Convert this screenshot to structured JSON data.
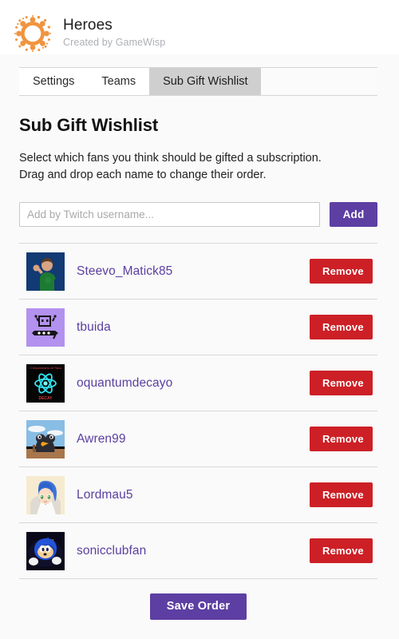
{
  "header": {
    "logo_icon": "gamewisp-sun-gear-icon",
    "title": "Heroes",
    "subtitle": "Created by GameWisp",
    "brand_color": "#f0943f"
  },
  "tabs": [
    {
      "label": "Settings",
      "active": false
    },
    {
      "label": "Teams",
      "active": false
    },
    {
      "label": "Sub Gift Wishlist",
      "active": true
    }
  ],
  "main": {
    "section_title": "Sub Gift Wishlist",
    "description_line1": "Select which fans you think should be gifted a subscription.",
    "description_line2": "Drag and drop each name to change their order."
  },
  "add_form": {
    "input_value": "",
    "input_placeholder": "Add by Twitch username...",
    "add_label": "Add",
    "add_color": "#5d3fa3"
  },
  "wishlist": {
    "remove_label": "Remove",
    "remove_color": "#cc2026",
    "name_color": "#5b3fa0",
    "items": [
      {
        "username": "Steevo_Matick85",
        "avatar_icon": "avatar-3d-person-waving-icon",
        "avatar_bg": "#123a73"
      },
      {
        "username": "tbuida",
        "avatar_icon": "avatar-pixel-creature-icon",
        "avatar_bg": "#b391ef"
      },
      {
        "username": "oquantumdecayo",
        "avatar_icon": "avatar-atom-icon",
        "avatar_bg": "#050505"
      },
      {
        "username": "Awren99",
        "avatar_icon": "avatar-bird-icon",
        "avatar_bg": "#7fb4dd"
      },
      {
        "username": "Lordmau5",
        "avatar_icon": "avatar-anime-girl-icon",
        "avatar_bg": "#f3e7c6"
      },
      {
        "username": "sonicclubfan",
        "avatar_icon": "avatar-sonic-icon",
        "avatar_bg": "#0a0a18"
      }
    ]
  },
  "footer": {
    "save_label": "Save Order",
    "save_color": "#5d3fa3"
  }
}
